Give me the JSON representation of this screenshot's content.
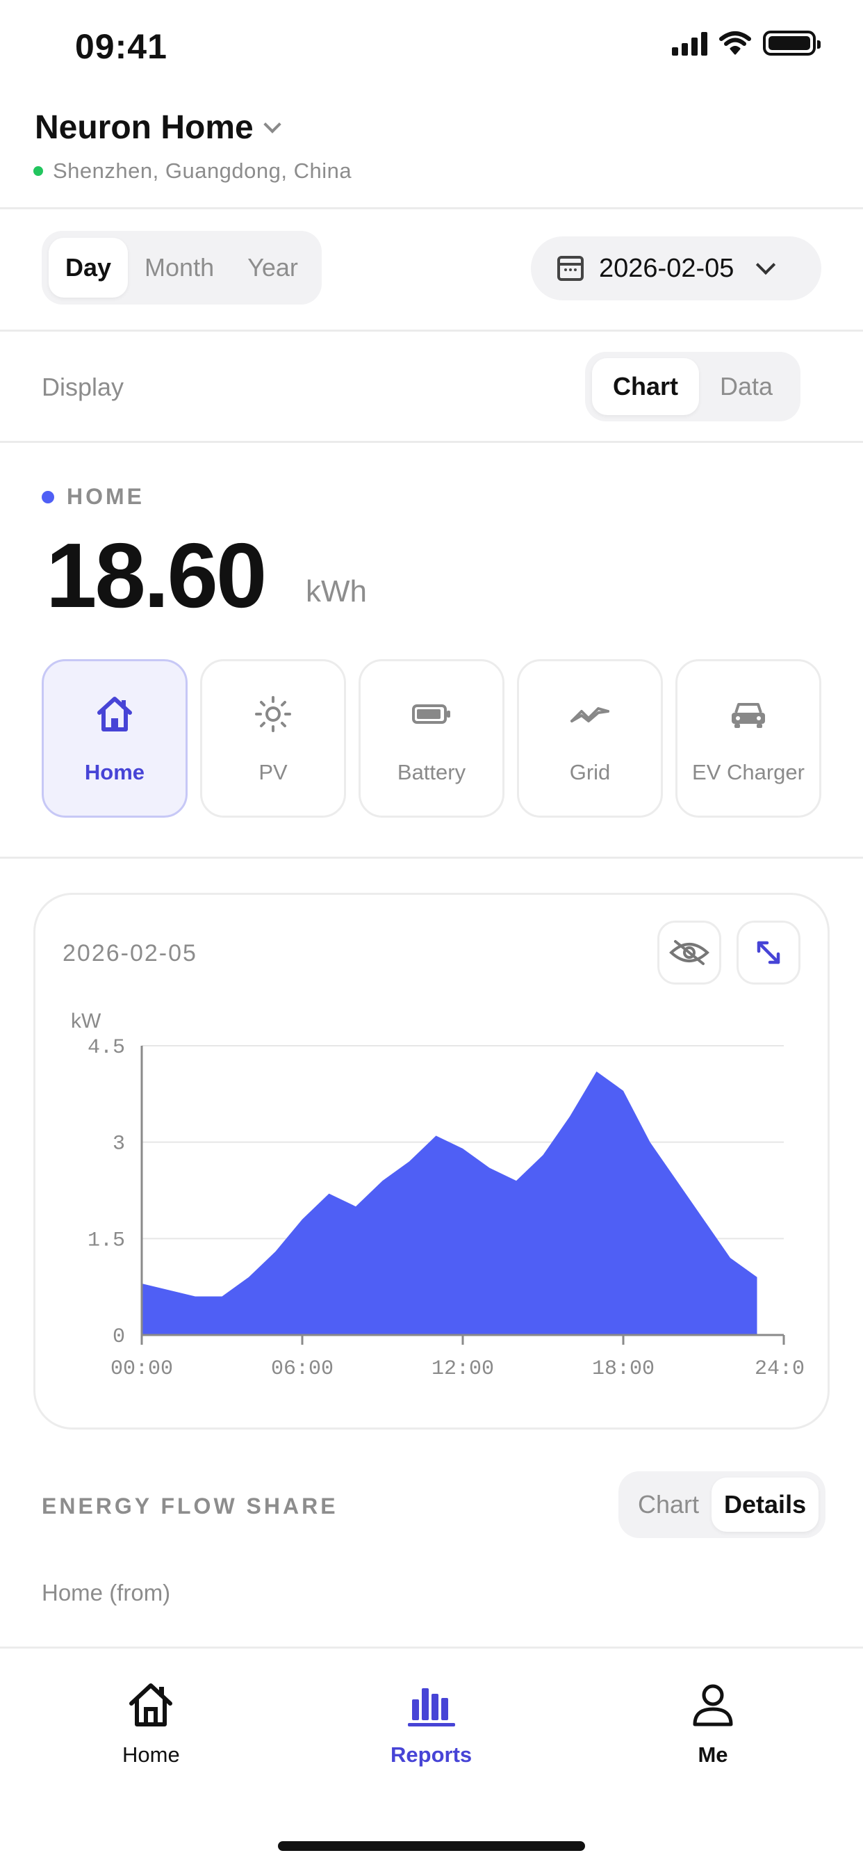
{
  "status_bar": {
    "time": "09:41"
  },
  "header": {
    "site_name": "Neuron Home",
    "location": "Shenzhen, Guangdong, China"
  },
  "period": {
    "options": [
      "Day",
      "Month",
      "Year"
    ],
    "selected": "Day",
    "date": "2026-02-05"
  },
  "display": {
    "label": "Display",
    "options": [
      "Chart",
      "Data"
    ],
    "selected": "Chart"
  },
  "metric": {
    "name": "HOME",
    "value": "18.60",
    "unit": "kWh"
  },
  "categories": [
    {
      "label": "Home",
      "icon": "house-icon",
      "active": true
    },
    {
      "label": "PV",
      "icon": "sun-icon",
      "active": false
    },
    {
      "label": "Battery",
      "icon": "battery-icon",
      "active": false
    },
    {
      "label": "Grid",
      "icon": "grid-wave-icon",
      "active": false
    },
    {
      "label": "EV Charger",
      "icon": "car-icon",
      "active": false
    }
  ],
  "chart": {
    "date": "2026-02-05",
    "hide_icon": "eye-off-icon",
    "expand_icon": "expand-icon"
  },
  "chart_data": {
    "type": "area",
    "ylabel": "kW",
    "ylim": [
      0,
      4.5
    ],
    "yticks": [
      "0",
      "1.5",
      "3",
      "4.5"
    ],
    "xticks": [
      "00:00",
      "06:00",
      "12:00",
      "18:00",
      "24:0"
    ],
    "xlim": [
      0,
      24
    ],
    "grid": true,
    "color": "#4f5ff5",
    "series": [
      {
        "x": [
          0,
          1,
          2,
          3,
          4,
          5,
          6,
          7,
          8,
          9,
          10,
          11,
          12,
          13,
          14,
          15,
          16,
          17,
          18,
          19,
          20,
          21,
          22,
          23
        ],
        "y": [
          0.8,
          0.7,
          0.6,
          0.6,
          0.9,
          1.3,
          1.8,
          2.2,
          2.0,
          2.4,
          2.7,
          3.1,
          2.9,
          2.6,
          2.4,
          2.8,
          3.4,
          4.1,
          3.8,
          3.0,
          2.4,
          1.8,
          1.2,
          0.9
        ]
      }
    ]
  },
  "energy_flow": {
    "title": "ENERGY FLOW SHARE",
    "options": [
      "Chart",
      "Details"
    ],
    "selected": "Details",
    "subtitle": "Home (from)"
  },
  "tabbar": {
    "items": [
      {
        "label": "Home",
        "icon": "house-outline-icon"
      },
      {
        "label": "Reports",
        "icon": "bar-chart-icon"
      },
      {
        "label": "Me",
        "icon": "person-icon"
      }
    ],
    "active": "Reports"
  },
  "colors": {
    "accent": "#4744d6",
    "chart_fill": "#4f5ff5",
    "status_dot": "#22c55e"
  }
}
